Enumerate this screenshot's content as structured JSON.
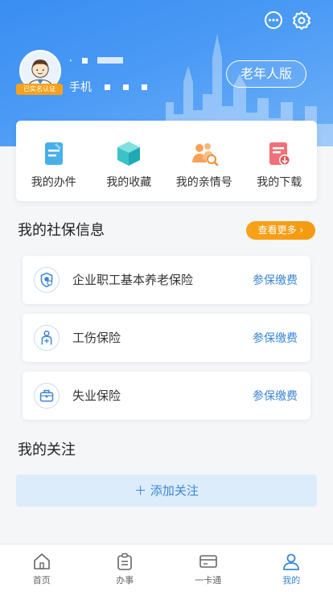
{
  "header": {
    "elder_mode_label": "老年人版",
    "verified_badge": "已实名认证",
    "user_name_prefix": "⸱",
    "phone_label": "手机"
  },
  "quick_actions": [
    {
      "label": "我的办件",
      "icon": "document-icon"
    },
    {
      "label": "我的收藏",
      "icon": "cube-icon"
    },
    {
      "label": "我的亲情号",
      "icon": "family-icon"
    },
    {
      "label": "我的下载",
      "icon": "download-icon"
    }
  ],
  "social_security": {
    "title": "我的社保信息",
    "more_label": "查看更多",
    "items": [
      {
        "name": "企业职工基本养老保险",
        "action": "参保缴费",
        "icon": "pension-icon"
      },
      {
        "name": "工伤保险",
        "action": "参保缴费",
        "icon": "injury-icon"
      },
      {
        "name": "失业保险",
        "action": "参保缴费",
        "icon": "unemployment-icon"
      }
    ]
  },
  "follow": {
    "title": "我的关注",
    "add_label": "添加关注"
  },
  "tabbar": [
    {
      "label": "首页",
      "icon": "home-icon"
    },
    {
      "label": "办事",
      "icon": "clipboard-icon"
    },
    {
      "label": "一卡通",
      "icon": "card-icon"
    },
    {
      "label": "我的",
      "icon": "user-icon",
      "active": true
    }
  ],
  "colors": {
    "primary": "#3b86d6",
    "accent": "#f7a21b",
    "header": "#4a9af5"
  }
}
